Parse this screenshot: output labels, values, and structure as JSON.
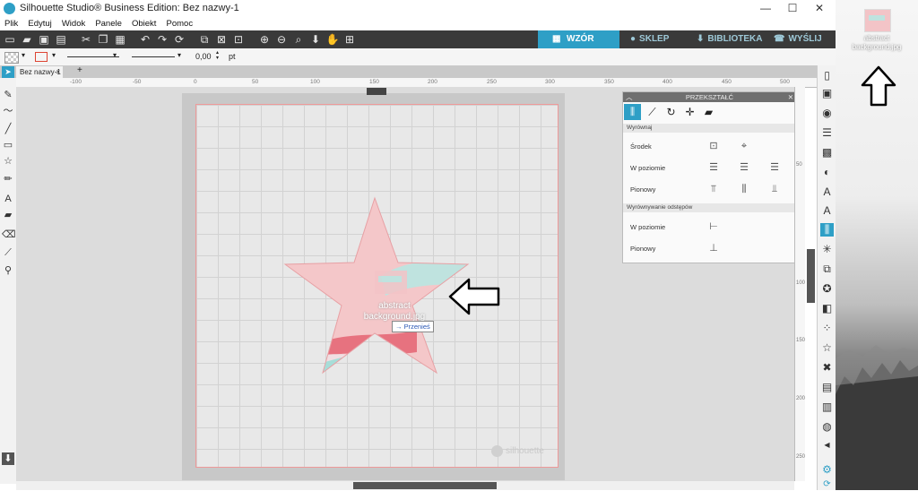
{
  "window": {
    "title": "Silhouette Studio® Business Edition: Bez nazwy-1",
    "controls": [
      "—",
      "☐",
      "✕"
    ]
  },
  "menu": [
    "Plik",
    "Edytuj",
    "Widok",
    "Panele",
    "Obiekt",
    "Pomoc"
  ],
  "nav_tabs": [
    {
      "label": "WZÓR",
      "active": true
    },
    {
      "label": "SKLEP",
      "active": false
    },
    {
      "label": "BIBLIOTEKA",
      "active": false
    },
    {
      "label": "WYŚLIJ",
      "active": false
    }
  ],
  "options": {
    "line_width_value": "0,00",
    "unit": "pt"
  },
  "doc_tab": {
    "label": "Bez nazwy-1",
    "add": "+"
  },
  "ruler": {
    "x_ticks": [
      "-100",
      "-50",
      "0",
      "50",
      "100",
      "150",
      "200",
      "250",
      "300",
      "350",
      "400",
      "450",
      "500"
    ],
    "y_ticks": [
      "50",
      "100",
      "150",
      "200",
      "250"
    ]
  },
  "drag": {
    "file_label_line1": "abstract",
    "file_label_line2": "background.jpg",
    "tooltip": "→ Przenieś"
  },
  "transform_panel": {
    "title": "PRZEKSZTAŁĆ",
    "section_align": "Wyrównaj",
    "rows": [
      "Środek",
      "W poziomie",
      "Pionowy"
    ],
    "section_distribute": "Wyrównywanie odstępów",
    "dist_rows": [
      "W poziomie",
      "Pionowy"
    ]
  },
  "desktop": {
    "file_name": "abstract background.jpg"
  },
  "colors": {
    "accent": "#2e9fc6",
    "toolbar": "#3a3a3a",
    "star_fill": "#f4c7c9",
    "star_stroke": "#e7a0a4"
  },
  "watermark": "silhouette"
}
